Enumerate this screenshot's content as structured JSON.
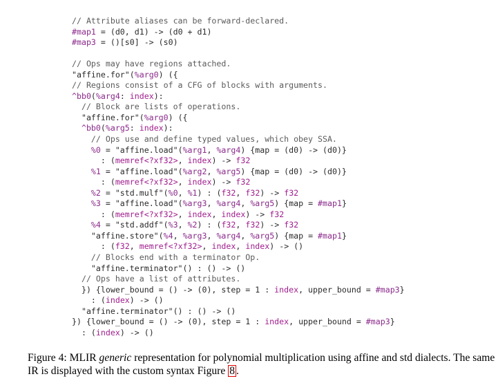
{
  "code_lines": [
    [
      {
        "t": "// Attribute aliases can be forward-declared.",
        "k": "c"
      }
    ],
    [
      {
        "t": "#map1",
        "k": "id"
      },
      {
        "t": " = (d0, d1) -> (d0 + d1)",
        "k": "n"
      }
    ],
    [
      {
        "t": "#map3",
        "k": "id"
      },
      {
        "t": " = ()[s0] -> (s0)",
        "k": "n"
      }
    ],
    [],
    [
      {
        "t": "// Ops may have regions attached.",
        "k": "c"
      }
    ],
    [
      {
        "t": "\"affine.for\"(",
        "k": "s"
      },
      {
        "t": "%arg0",
        "k": "id"
      },
      {
        "t": ") ({",
        "k": "n"
      }
    ],
    [
      {
        "t": "// Regions consist of a CFG of blocks with arguments.",
        "k": "c"
      }
    ],
    [
      {
        "t": "^bb0",
        "k": "id"
      },
      {
        "t": "(",
        "k": "n"
      },
      {
        "t": "%arg4",
        "k": "id"
      },
      {
        "t": ": ",
        "k": "n"
      },
      {
        "t": "index",
        "k": "ty"
      },
      {
        "t": "):",
        "k": "n"
      }
    ],
    [
      {
        "t": "  // Block are lists of operations.",
        "k": "c"
      }
    ],
    [
      {
        "t": "  \"affine.for\"(",
        "k": "s"
      },
      {
        "t": "%arg0",
        "k": "id"
      },
      {
        "t": ") ({",
        "k": "n"
      }
    ],
    [
      {
        "t": "  ^bb0",
        "k": "id"
      },
      {
        "t": "(",
        "k": "n"
      },
      {
        "t": "%arg5",
        "k": "id"
      },
      {
        "t": ": ",
        "k": "n"
      },
      {
        "t": "index",
        "k": "ty"
      },
      {
        "t": "):",
        "k": "n"
      }
    ],
    [
      {
        "t": "    // Ops use and define typed values, which obey SSA.",
        "k": "c"
      }
    ],
    [
      {
        "t": "    %0",
        "k": "id"
      },
      {
        "t": " = \"affine.load\"(",
        "k": "s"
      },
      {
        "t": "%arg1",
        "k": "id"
      },
      {
        "t": ", ",
        "k": "n"
      },
      {
        "t": "%arg4",
        "k": "id"
      },
      {
        "t": ") {map = (d0) -> (d0)}",
        "k": "n"
      }
    ],
    [
      {
        "t": "      : (",
        "k": "n"
      },
      {
        "t": "memref<?xf32>",
        "k": "ty"
      },
      {
        "t": ", ",
        "k": "n"
      },
      {
        "t": "index",
        "k": "ty"
      },
      {
        "t": ") -> ",
        "k": "n"
      },
      {
        "t": "f32",
        "k": "ty"
      }
    ],
    [
      {
        "t": "    %1",
        "k": "id"
      },
      {
        "t": " = \"affine.load\"(",
        "k": "s"
      },
      {
        "t": "%arg2",
        "k": "id"
      },
      {
        "t": ", ",
        "k": "n"
      },
      {
        "t": "%arg5",
        "k": "id"
      },
      {
        "t": ") {map = (d0) -> (d0)}",
        "k": "n"
      }
    ],
    [
      {
        "t": "      : (",
        "k": "n"
      },
      {
        "t": "memref<?xf32>",
        "k": "ty"
      },
      {
        "t": ", ",
        "k": "n"
      },
      {
        "t": "index",
        "k": "ty"
      },
      {
        "t": ") -> ",
        "k": "n"
      },
      {
        "t": "f32",
        "k": "ty"
      }
    ],
    [
      {
        "t": "    %2",
        "k": "id"
      },
      {
        "t": " = \"std.mulf\"(",
        "k": "s"
      },
      {
        "t": "%0",
        "k": "id"
      },
      {
        "t": ", ",
        "k": "n"
      },
      {
        "t": "%1",
        "k": "id"
      },
      {
        "t": ") : (",
        "k": "n"
      },
      {
        "t": "f32",
        "k": "ty"
      },
      {
        "t": ", ",
        "k": "n"
      },
      {
        "t": "f32",
        "k": "ty"
      },
      {
        "t": ") -> ",
        "k": "n"
      },
      {
        "t": "f32",
        "k": "ty"
      }
    ],
    [
      {
        "t": "    %3",
        "k": "id"
      },
      {
        "t": " = \"affine.load\"(",
        "k": "s"
      },
      {
        "t": "%arg3",
        "k": "id"
      },
      {
        "t": ", ",
        "k": "n"
      },
      {
        "t": "%arg4",
        "k": "id"
      },
      {
        "t": ", ",
        "k": "n"
      },
      {
        "t": "%arg5",
        "k": "id"
      },
      {
        "t": ") {map = ",
        "k": "n"
      },
      {
        "t": "#map1",
        "k": "id"
      },
      {
        "t": "}",
        "k": "n"
      }
    ],
    [
      {
        "t": "      : (",
        "k": "n"
      },
      {
        "t": "memref<?xf32>",
        "k": "ty"
      },
      {
        "t": ", ",
        "k": "n"
      },
      {
        "t": "index",
        "k": "ty"
      },
      {
        "t": ", ",
        "k": "n"
      },
      {
        "t": "index",
        "k": "ty"
      },
      {
        "t": ") -> ",
        "k": "n"
      },
      {
        "t": "f32",
        "k": "ty"
      }
    ],
    [
      {
        "t": "    %4",
        "k": "id"
      },
      {
        "t": " = \"std.addf\"(",
        "k": "s"
      },
      {
        "t": "%3",
        "k": "id"
      },
      {
        "t": ", ",
        "k": "n"
      },
      {
        "t": "%2",
        "k": "id"
      },
      {
        "t": ") : (",
        "k": "n"
      },
      {
        "t": "f32",
        "k": "ty"
      },
      {
        "t": ", ",
        "k": "n"
      },
      {
        "t": "f32",
        "k": "ty"
      },
      {
        "t": ") -> ",
        "k": "n"
      },
      {
        "t": "f32",
        "k": "ty"
      }
    ],
    [
      {
        "t": "    \"affine.store\"(",
        "k": "s"
      },
      {
        "t": "%4",
        "k": "id"
      },
      {
        "t": ", ",
        "k": "n"
      },
      {
        "t": "%arg3",
        "k": "id"
      },
      {
        "t": ", ",
        "k": "n"
      },
      {
        "t": "%arg4",
        "k": "id"
      },
      {
        "t": ", ",
        "k": "n"
      },
      {
        "t": "%arg5",
        "k": "id"
      },
      {
        "t": ") {map = ",
        "k": "n"
      },
      {
        "t": "#map1",
        "k": "id"
      },
      {
        "t": "}",
        "k": "n"
      }
    ],
    [
      {
        "t": "      : (",
        "k": "n"
      },
      {
        "t": "f32",
        "k": "ty"
      },
      {
        "t": ", ",
        "k": "n"
      },
      {
        "t": "memref<?xf32>",
        "k": "ty"
      },
      {
        "t": ", ",
        "k": "n"
      },
      {
        "t": "index",
        "k": "ty"
      },
      {
        "t": ", ",
        "k": "n"
      },
      {
        "t": "index",
        "k": "ty"
      },
      {
        "t": ") -> ()",
        "k": "n"
      }
    ],
    [
      {
        "t": "    // Blocks end with a terminator Op.",
        "k": "c"
      }
    ],
    [
      {
        "t": "    \"affine.terminator\"() : () -> ()",
        "k": "s"
      }
    ],
    [
      {
        "t": "  // Ops have a list of attributes.",
        "k": "c"
      }
    ],
    [
      {
        "t": "  }) {lower_bound = () -> (0), step = 1 : ",
        "k": "n"
      },
      {
        "t": "index",
        "k": "ty"
      },
      {
        "t": ", upper_bound = ",
        "k": "n"
      },
      {
        "t": "#map3",
        "k": "id"
      },
      {
        "t": "}",
        "k": "n"
      }
    ],
    [
      {
        "t": "    : (",
        "k": "n"
      },
      {
        "t": "index",
        "k": "ty"
      },
      {
        "t": ") -> ()",
        "k": "n"
      }
    ],
    [
      {
        "t": "  \"affine.terminator\"() : () -> ()",
        "k": "s"
      }
    ],
    [
      {
        "t": "}) {lower_bound = () -> (0), step = 1 : ",
        "k": "n"
      },
      {
        "t": "index",
        "k": "ty"
      },
      {
        "t": ", upper_bound = ",
        "k": "n"
      },
      {
        "t": "#map3",
        "k": "id"
      },
      {
        "t": "}",
        "k": "n"
      }
    ],
    [
      {
        "t": "  : (",
        "k": "n"
      },
      {
        "t": "index",
        "k": "ty"
      },
      {
        "t": ") -> ()",
        "k": "n"
      }
    ]
  ],
  "caption": {
    "prefix": "Figure 4: MLIR ",
    "emphasis": "generic",
    "middle": " representation for polynomial multiplication using affine and std dialects. The same IR is displayed with the custom syntax Figure ",
    "ref": "8",
    "suffix": "."
  },
  "colors": {
    "comment": "#5a5a5a",
    "identifier": "#8b2a8b",
    "type": "#a01d8d",
    "text": "#2b2b2b",
    "ref_box": "#e00000"
  }
}
